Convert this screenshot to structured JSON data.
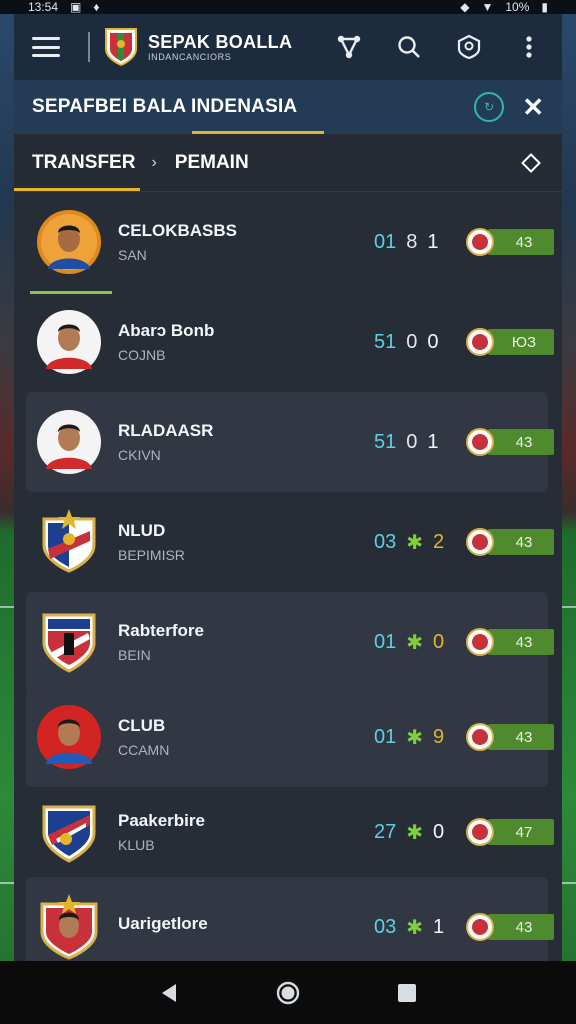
{
  "status": {
    "time": "13:54",
    "battery": "10%"
  },
  "app": {
    "brand_title": "SEPAK BOALLA",
    "brand_subtitle": "INDANCANCIORS"
  },
  "header": {
    "title": "SEPAFBEI BALA INDENASIA"
  },
  "breadcrumb": {
    "first": "TRANSFER",
    "separator": "›",
    "second": "PEMAIN"
  },
  "rows": [
    {
      "name": "CELOKBASBS",
      "sub": "SAN",
      "s1": "01",
      "s2": "8",
      "s3": "1",
      "rating": "43",
      "avatar": "player-orange",
      "alt": false,
      "selected": true
    },
    {
      "name": "Abarɔ Bonb",
      "sub": "COJNB",
      "s1": "51",
      "s2": "0",
      "s3": "0",
      "rating": "ЮЗ",
      "avatar": "player-white",
      "alt": false
    },
    {
      "name": "RLADAASR",
      "sub": "CKIVN",
      "s1": "51",
      "s2": "0",
      "s3": "1",
      "rating": "43",
      "avatar": "player-white",
      "alt": true
    },
    {
      "name": "NLUD",
      "sub": "BEPIMISR",
      "s1": "03",
      "s2": "✱",
      "s3": "2",
      "rating": "43",
      "avatar": "crest-a",
      "alt": false,
      "s2green": true,
      "s3gold": true
    },
    {
      "name": "Rabterfore",
      "sub": "BEIN",
      "s1": "01",
      "s2": "✱",
      "s3": "0",
      "rating": "43",
      "avatar": "crest-b",
      "alt": true,
      "s2green": true,
      "s3gold": true
    },
    {
      "name": "CLUB",
      "sub": "CCAMN",
      "s1": "01",
      "s2": "✱",
      "s3": "9",
      "rating": "43",
      "avatar": "player-red",
      "alt": true,
      "s2green": true,
      "s3gold": true
    },
    {
      "name": "Paakerbire",
      "sub": "KLUB",
      "s1": "27",
      "s2": "✱",
      "s3": "0",
      "rating": "47",
      "avatar": "crest-c",
      "alt": false,
      "s2green": true
    },
    {
      "name": "Uarigetlore",
      "sub": "",
      "s1": "03",
      "s2": "✱",
      "s3": "1",
      "rating": "43",
      "avatar": "crest-d",
      "alt": true,
      "s2green": true
    }
  ],
  "colors": {
    "accent": "#e3b52c",
    "rating_bg": "#4f8a2e",
    "score_blue": "#5fd0e0"
  }
}
